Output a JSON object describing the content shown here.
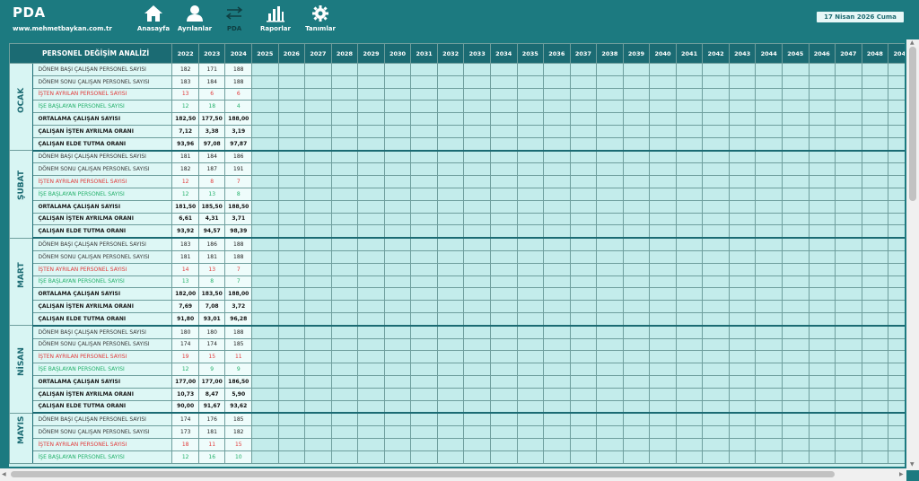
{
  "header": {
    "app_title": "PDA",
    "site": "www.mehmetbaykan.com.tr",
    "date": "17 Nisan 2026 Cuma",
    "nav": [
      {
        "label": "Anasayfa",
        "icon": "home-icon"
      },
      {
        "label": "Ayrılanlar",
        "icon": "user-icon"
      },
      {
        "label": "PDA",
        "icon": "swap-arrows-icon",
        "active": true
      },
      {
        "label": "Raporlar",
        "icon": "bar-chart-icon"
      },
      {
        "label": "Tanımlar",
        "icon": "gear-icon"
      }
    ]
  },
  "table": {
    "title": "PERSONEL DEĞİŞİM ANALİZİ",
    "years": [
      "2022",
      "2023",
      "2024",
      "2025",
      "2026",
      "2027",
      "2028",
      "2029",
      "2030",
      "2031",
      "2032",
      "2033",
      "2034",
      "2035",
      "2036",
      "2037",
      "2038",
      "2039",
      "2040",
      "2041",
      "2042",
      "2043",
      "2044",
      "2045",
      "2046",
      "2047",
      "2048",
      "2049"
    ],
    "row_labels": [
      {
        "text": "DÖNEM BAŞI ÇALIŞAN PERSONEL SAYISI",
        "style": "normal"
      },
      {
        "text": "DÖNEM SONU ÇALIŞAN PERSONEL SAYISI",
        "style": "normal"
      },
      {
        "text": "İŞTEN AYRILAN PERSONEL SAYISI",
        "style": "red"
      },
      {
        "text": "İŞE BAŞLAYAN PERSONEL SAYISI",
        "style": "green"
      },
      {
        "text": "ORTALAMA ÇALIŞAN SAYISI",
        "style": "bold"
      },
      {
        "text": "ÇALIŞAN İŞTEN AYRILMA ORANI",
        "style": "bold"
      },
      {
        "text": "ÇALIŞAN ELDE TUTMA ORANI",
        "style": "bold"
      }
    ],
    "months": [
      {
        "name": "OCAK",
        "rows": [
          [
            "182",
            "171",
            "188"
          ],
          [
            "183",
            "184",
            "188"
          ],
          [
            "13",
            "6",
            "6"
          ],
          [
            "12",
            "18",
            "4"
          ],
          [
            "182,50",
            "177,50",
            "188,00"
          ],
          [
            "7,12",
            "3,38",
            "3,19"
          ],
          [
            "93,96",
            "97,08",
            "97,87"
          ]
        ]
      },
      {
        "name": "ŞUBAT",
        "rows": [
          [
            "181",
            "184",
            "186"
          ],
          [
            "182",
            "187",
            "191"
          ],
          [
            "12",
            "8",
            "7"
          ],
          [
            "12",
            "13",
            "8"
          ],
          [
            "181,50",
            "185,50",
            "188,50"
          ],
          [
            "6,61",
            "4,31",
            "3,71"
          ],
          [
            "93,92",
            "94,57",
            "98,39"
          ]
        ]
      },
      {
        "name": "MART",
        "rows": [
          [
            "183",
            "186",
            "188"
          ],
          [
            "181",
            "181",
            "188"
          ],
          [
            "14",
            "13",
            "7"
          ],
          [
            "13",
            "8",
            "7"
          ],
          [
            "182,00",
            "183,50",
            "188,00"
          ],
          [
            "7,69",
            "7,08",
            "3,72"
          ],
          [
            "91,80",
            "93,01",
            "96,28"
          ]
        ]
      },
      {
        "name": "NİSAN",
        "rows": [
          [
            "180",
            "180",
            "188"
          ],
          [
            "174",
            "174",
            "185"
          ],
          [
            "19",
            "15",
            "11"
          ],
          [
            "12",
            "9",
            "9"
          ],
          [
            "177,00",
            "177,00",
            "186,50"
          ],
          [
            "10,73",
            "8,47",
            "5,90"
          ],
          [
            "90,00",
            "91,67",
            "93,62"
          ]
        ]
      },
      {
        "name": "MAYIS",
        "rows": [
          [
            "174",
            "176",
            "185"
          ],
          [
            "173",
            "181",
            "182"
          ],
          [
            "18",
            "11",
            "15"
          ],
          [
            "12",
            "16",
            "10"
          ]
        ]
      }
    ]
  }
}
